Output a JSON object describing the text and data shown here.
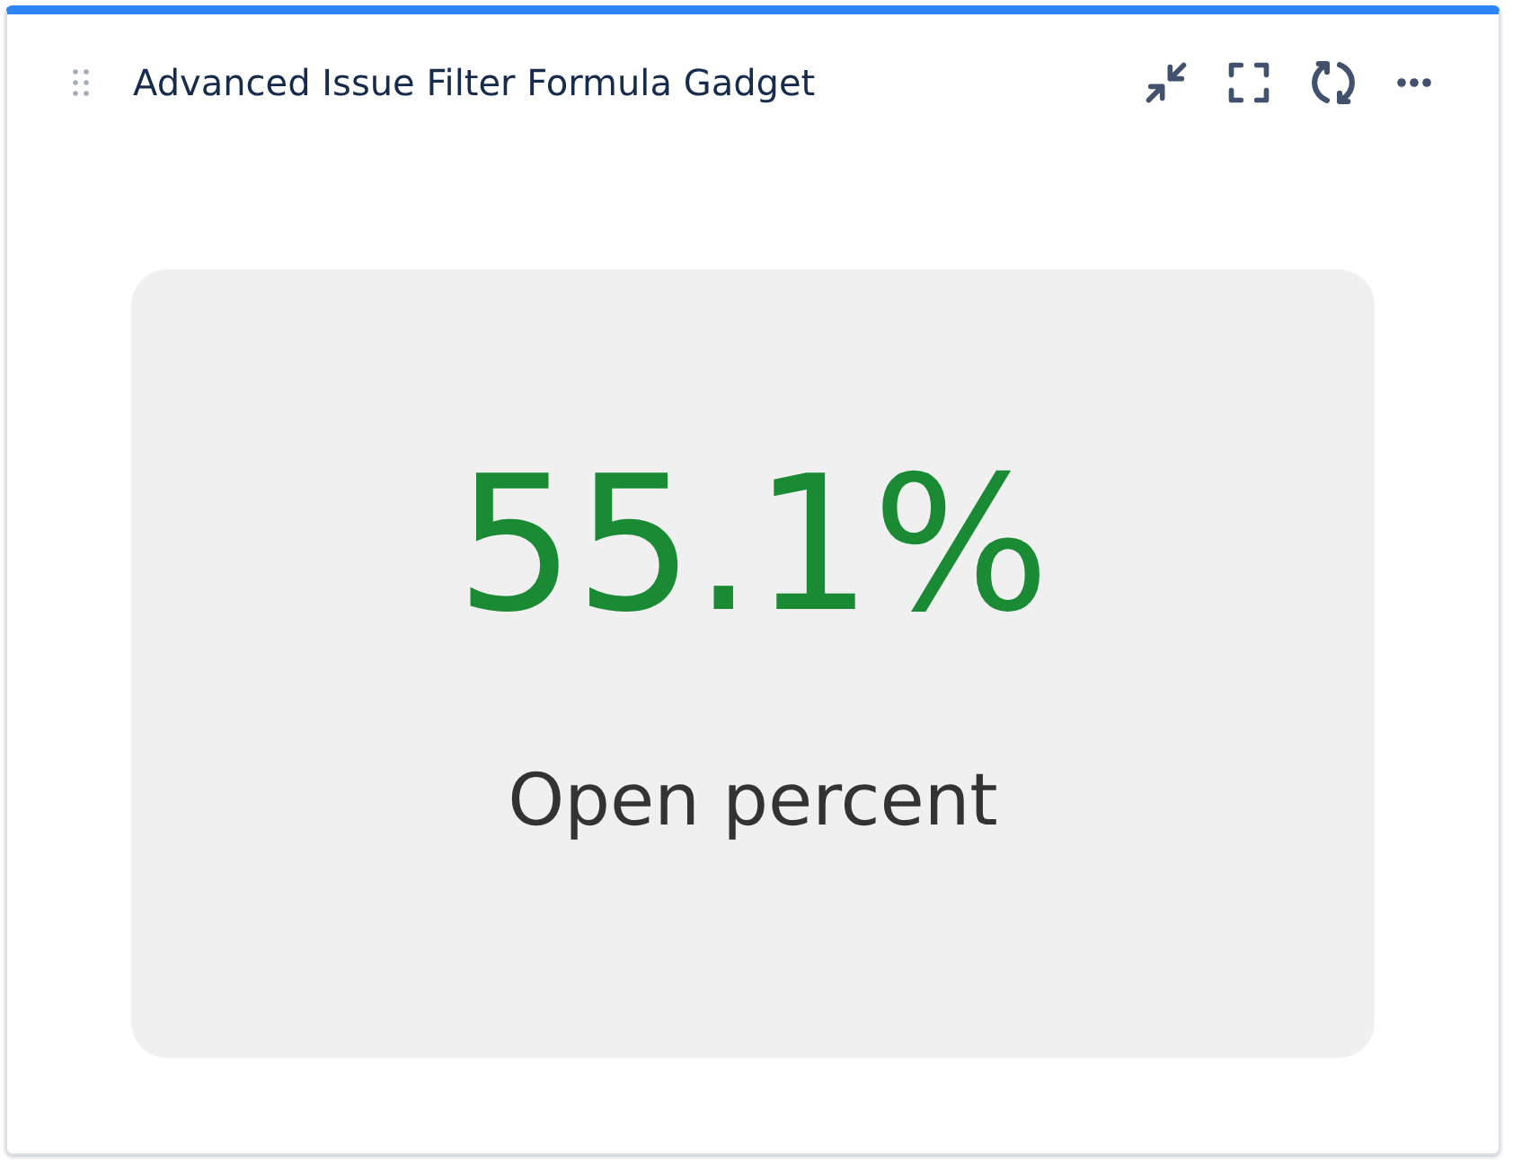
{
  "gadget": {
    "title": "Advanced Issue Filter Formula Gadget"
  },
  "metric": {
    "value": "55.1%",
    "label": "Open percent"
  }
}
